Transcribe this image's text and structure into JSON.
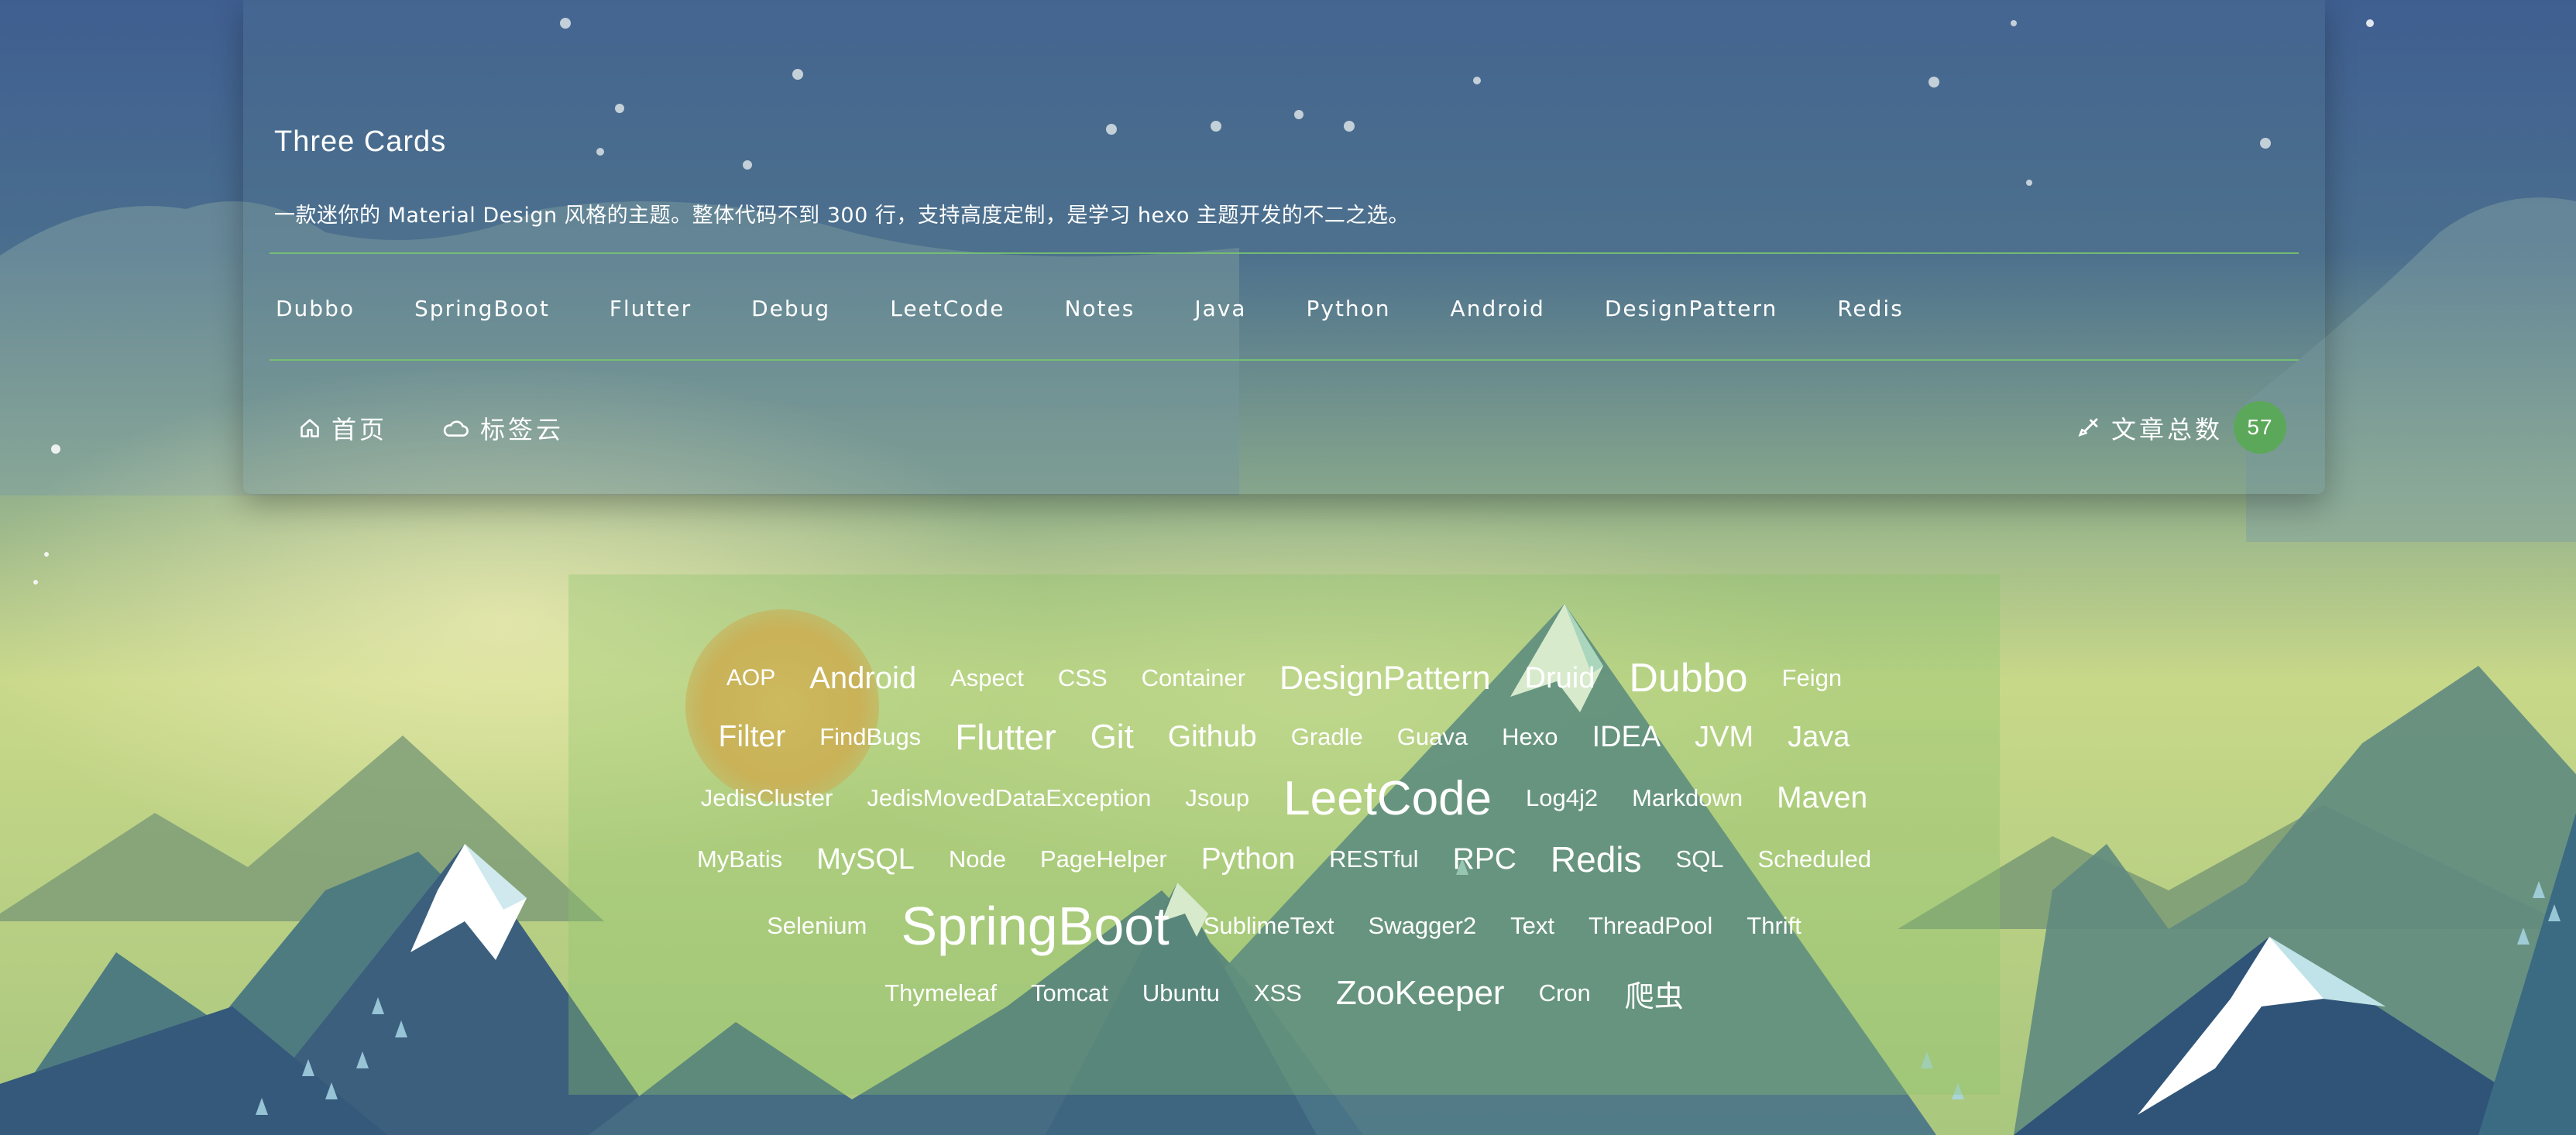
{
  "header": {
    "title": "Three Cards",
    "description": "一款迷你的 Material Design 风格的主题。整体代码不到 300 行，支持高度定制，是学习 hexo 主题开发的不二之选。",
    "categories": [
      "Dubbo",
      "SpringBoot",
      "Flutter",
      "Debug",
      "LeetCode",
      "Notes",
      "Java",
      "Python",
      "Android",
      "DesignPattern",
      "Redis"
    ],
    "nav": {
      "home_label": "首页",
      "home_icon": "home-icon",
      "tags_label": "标签云",
      "tags_icon": "cloud-icon",
      "post_count_label": "文章总数",
      "post_count_icon": "pen-icon",
      "post_count": "57"
    }
  },
  "tag_cloud": {
    "rows": [
      [
        {
          "text": "AOP",
          "size": 30
        },
        {
          "text": "Android",
          "size": 40
        },
        {
          "text": "Aspect",
          "size": 31
        },
        {
          "text": "CSS",
          "size": 31
        },
        {
          "text": "Container",
          "size": 31
        },
        {
          "text": "DesignPattern",
          "size": 43
        },
        {
          "text": "Druid",
          "size": 38
        },
        {
          "text": "Dubbo",
          "size": 52
        },
        {
          "text": "Feign",
          "size": 31
        }
      ],
      [
        {
          "text": "Filter",
          "size": 39
        },
        {
          "text": "FindBugs",
          "size": 31
        },
        {
          "text": "Flutter",
          "size": 46
        },
        {
          "text": "Git",
          "size": 44
        },
        {
          "text": "Github",
          "size": 39
        },
        {
          "text": "Gradle",
          "size": 31
        },
        {
          "text": "Guava",
          "size": 31
        },
        {
          "text": "Hexo",
          "size": 31
        },
        {
          "text": "IDEA",
          "size": 38
        },
        {
          "text": "JVM",
          "size": 38
        },
        {
          "text": "Java",
          "size": 38
        }
      ],
      [
        {
          "text": "JedisCluster",
          "size": 31
        },
        {
          "text": "JedisMovedDataException",
          "size": 31
        },
        {
          "text": "Jsoup",
          "size": 31
        },
        {
          "text": "LeetCode",
          "size": 62
        },
        {
          "text": "Log4j2",
          "size": 31
        },
        {
          "text": "Markdown",
          "size": 31
        },
        {
          "text": "Maven",
          "size": 39
        }
      ],
      [
        {
          "text": "MyBatis",
          "size": 31
        },
        {
          "text": "MySQL",
          "size": 38
        },
        {
          "text": "Node",
          "size": 31
        },
        {
          "text": "PageHelper",
          "size": 31
        },
        {
          "text": "Python",
          "size": 39
        },
        {
          "text": "RESTful",
          "size": 31
        },
        {
          "text": "RPC",
          "size": 39
        },
        {
          "text": "Redis",
          "size": 46
        },
        {
          "text": "SQL",
          "size": 31
        },
        {
          "text": "Scheduled",
          "size": 31
        }
      ],
      [
        {
          "text": "Selenium",
          "size": 31
        },
        {
          "text": "SpringBoot",
          "size": 70
        },
        {
          "text": "SublimeText",
          "size": 31
        },
        {
          "text": "Swagger2",
          "size": 31
        },
        {
          "text": "Text",
          "size": 31
        },
        {
          "text": "ThreadPool",
          "size": 31
        },
        {
          "text": "Thrift",
          "size": 31
        }
      ],
      [
        {
          "text": "Thymeleaf",
          "size": 31
        },
        {
          "text": "Tomcat",
          "size": 31
        },
        {
          "text": "Ubuntu",
          "size": 31
        },
        {
          "text": "XSS",
          "size": 31
        },
        {
          "text": "ZooKeeper",
          "size": 44
        },
        {
          "text": "Cron",
          "size": 31
        },
        {
          "text": "爬虫",
          "size": 38
        }
      ]
    ]
  },
  "colors": {
    "accent": "#5ca85a",
    "divider": "#78c86e"
  }
}
